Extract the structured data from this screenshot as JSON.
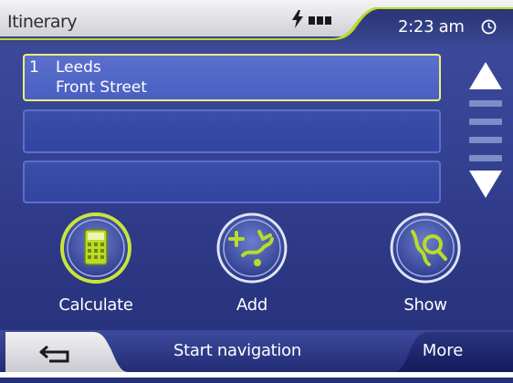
{
  "window": {
    "title": "Itinerary",
    "clock": "2:23 am",
    "status_icons": [
      "power-icon",
      "battery-icon",
      "clock-icon"
    ]
  },
  "itinerary": {
    "items": [
      {
        "number": "1",
        "city": "Leeds",
        "street": "Front Street",
        "selected": true
      },
      {
        "number": "",
        "city": "",
        "street": "",
        "selected": false
      },
      {
        "number": "",
        "city": "",
        "street": "",
        "selected": false
      }
    ]
  },
  "scrollbar": {
    "up_icon": "triangle-up-icon",
    "down_icon": "triangle-down-icon",
    "segments": 4
  },
  "actions": [
    {
      "label": "Calculate",
      "icon": "calculator-icon",
      "highlighted": true
    },
    {
      "label": "Add",
      "icon": "add-route-icon",
      "highlighted": false
    },
    {
      "label": "Show",
      "icon": "show-map-icon",
      "highlighted": false
    }
  ],
  "bottom_bar": {
    "back_icon": "back-arrow-icon",
    "start_label": "Start navigation",
    "more_label": "More"
  },
  "colors": {
    "background": "#333f8f",
    "accent_green": "#b8dc28",
    "selected_border": "#eaf07a",
    "title_bar": "#e6e6ea"
  }
}
